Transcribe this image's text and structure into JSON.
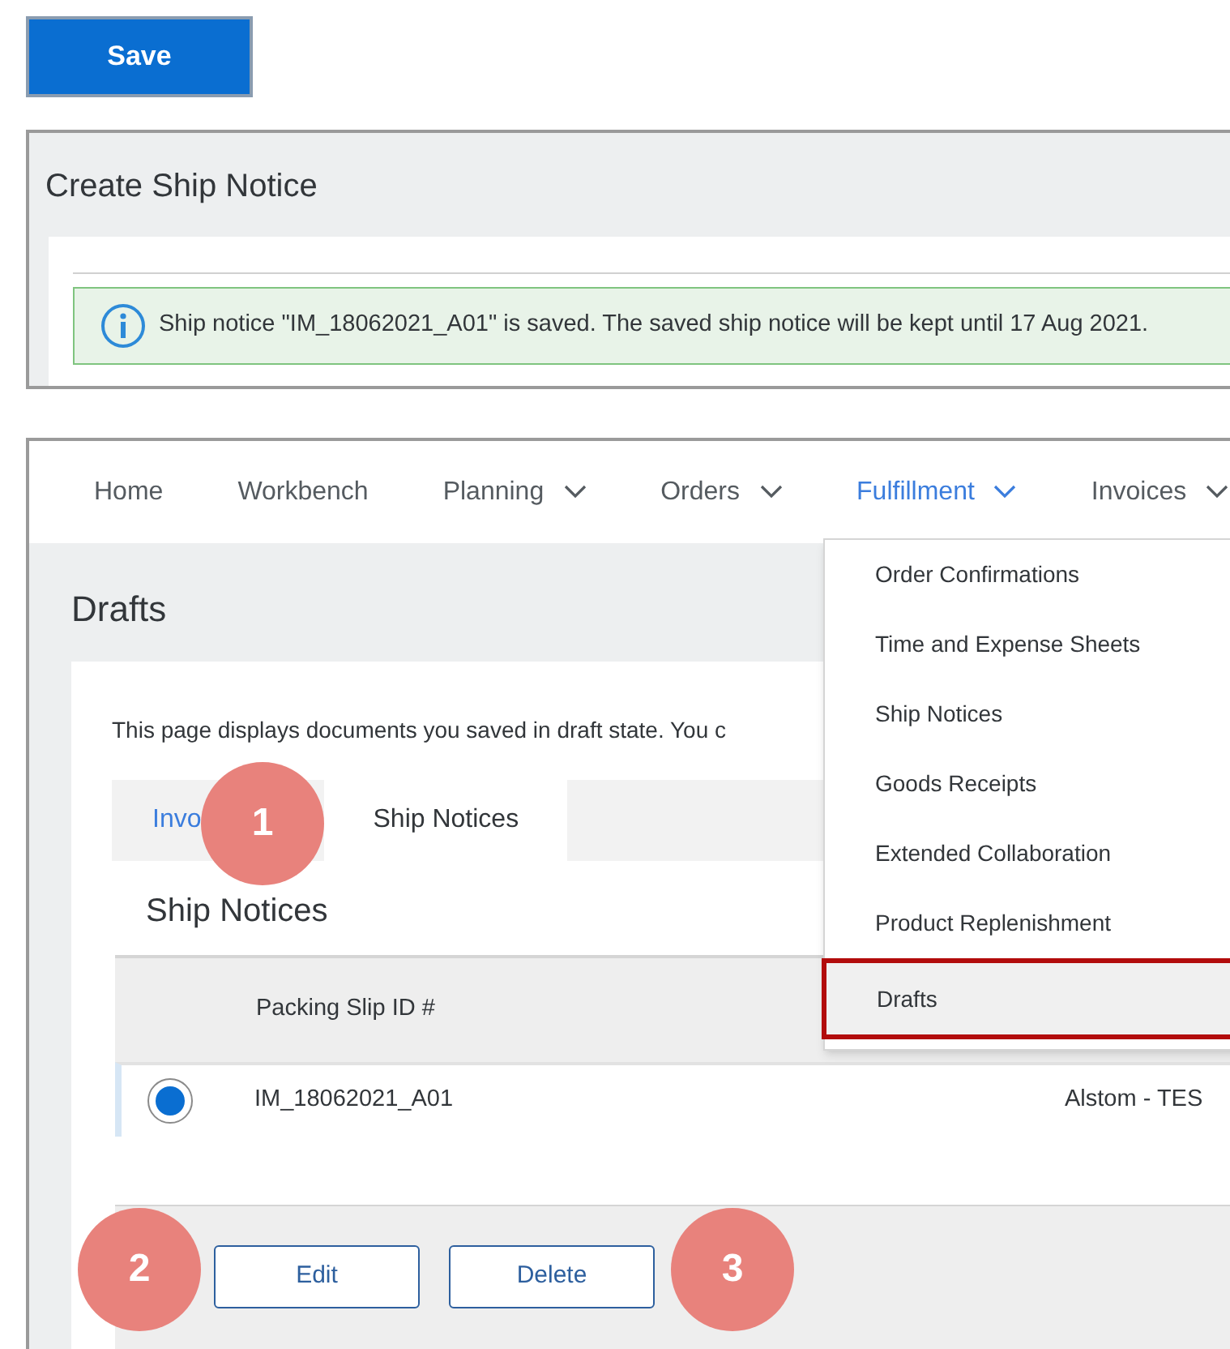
{
  "save_button": "Save",
  "create_panel": {
    "title": "Create Ship Notice",
    "message": "Ship notice \"IM_18062021_A01\" is saved. The saved ship notice will be kept until 17 Aug 2021."
  },
  "nav": [
    {
      "label": "Home",
      "selected": false,
      "menu": false
    },
    {
      "label": "Workbench",
      "selected": false,
      "menu": false
    },
    {
      "label": "Planning",
      "selected": false,
      "menu": true
    },
    {
      "label": "Orders",
      "selected": false,
      "menu": true
    },
    {
      "label": "Fulfillment",
      "selected": true,
      "menu": true
    },
    {
      "label": "Invoices",
      "selected": false,
      "menu": true
    }
  ],
  "page_title": "Drafts",
  "description": "This page displays documents you saved in draft state. You c",
  "tabs": [
    {
      "label": "Invo",
      "selected": false
    },
    {
      "label": "Ship Notices",
      "selected": true
    }
  ],
  "section_title": "Ship Notices",
  "table": {
    "columns": [
      "Packing Slip ID #"
    ],
    "rows": [
      {
        "selected": true,
        "cells": [
          "IM_18062021_A01",
          "Alstom - TES"
        ]
      }
    ]
  },
  "actions": [
    "Edit",
    "Delete"
  ],
  "menu": [
    {
      "label": "Order Confirmations",
      "highlighted": false
    },
    {
      "label": "Time and Expense Sheets",
      "highlighted": false
    },
    {
      "label": "Ship Notices",
      "highlighted": false
    },
    {
      "label": "Goods Receipts",
      "highlighted": false
    },
    {
      "label": "Extended Collaboration",
      "highlighted": false
    },
    {
      "label": "Product Replenishment",
      "highlighted": false
    },
    {
      "label": "Drafts",
      "highlighted": true
    }
  ],
  "callouts": [
    "1",
    "2",
    "3"
  ]
}
